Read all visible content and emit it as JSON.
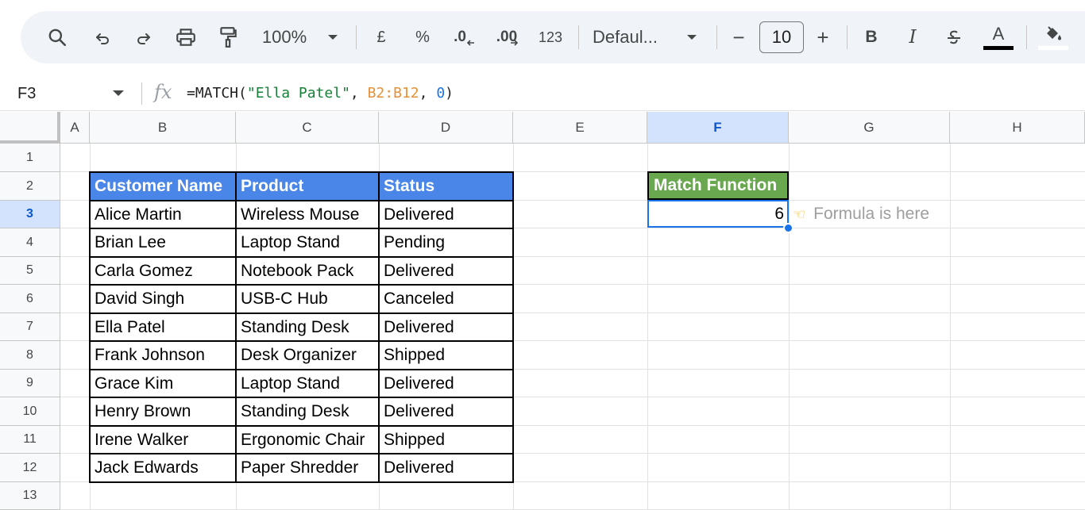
{
  "toolbar": {
    "zoom": "100%",
    "currency": "£",
    "percent": "%",
    "decrease_decimal": ".0",
    "increase_decimal": ".00",
    "number_format": "123",
    "font_family": "Defaul...",
    "font_size": "10",
    "minus": "−",
    "plus": "+",
    "bold": "B",
    "italic": "I",
    "text_color_label": "A",
    "text_color": "#000000"
  },
  "formula_bar": {
    "cell_ref": "F3",
    "fx": "fx",
    "formula_prefix": "=MATCH(",
    "formula_string": "\"Ella Patel\"",
    "formula_sep1": ", ",
    "formula_range": "B2:B12",
    "formula_sep2": ", ",
    "formula_number": "0",
    "formula_suffix": ")"
  },
  "columns": [
    "A",
    "B",
    "C",
    "D",
    "E",
    "F",
    "G",
    "H"
  ],
  "rows": [
    "1",
    "2",
    "3",
    "4",
    "5",
    "6",
    "7",
    "8",
    "9",
    "10",
    "11",
    "12",
    "13"
  ],
  "selected_column": "F",
  "selected_row": "3",
  "table": {
    "headers": [
      "Customer Name",
      "Product",
      "Status"
    ],
    "rows": [
      [
        "Alice Martin",
        "Wireless Mouse",
        "Delivered"
      ],
      [
        "Brian Lee",
        "Laptop Stand",
        "Pending"
      ],
      [
        "Carla Gomez",
        "Notebook Pack",
        "Delivered"
      ],
      [
        "David Singh",
        "USB-C Hub",
        "Canceled"
      ],
      [
        "Ella Patel",
        "Standing Desk",
        "Delivered"
      ],
      [
        "Frank Johnson",
        "Desk Organizer",
        "Shipped"
      ],
      [
        "Grace Kim",
        "Laptop Stand",
        "Delivered"
      ],
      [
        "Henry Brown",
        "Standing Desk",
        "Delivered"
      ],
      [
        "Irene Walker",
        "Ergonomic Chair",
        "Shipped"
      ],
      [
        "Jack Edwards",
        "Paper Shredder",
        "Delivered"
      ]
    ]
  },
  "match": {
    "header": "Match Function",
    "value": "6",
    "note": "Formula is here",
    "note_icon": "pointing-hand-icon"
  },
  "colors": {
    "table_header": "#4a86e8",
    "match_header": "#6aa84f",
    "selection": "#1a73e8"
  }
}
